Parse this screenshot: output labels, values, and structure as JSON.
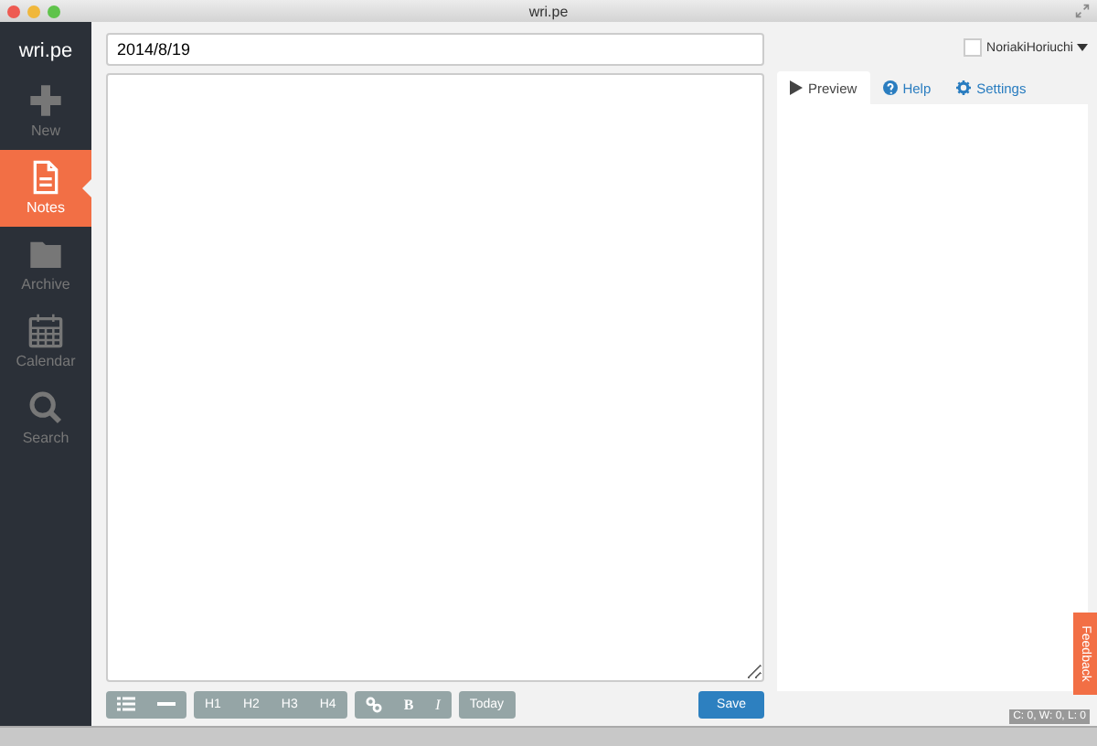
{
  "window": {
    "title": "wri.pe"
  },
  "sidebar": {
    "logo": "wri.pe",
    "items": [
      {
        "label": "New",
        "selected": false
      },
      {
        "label": "Notes",
        "selected": true
      },
      {
        "label": "Archive",
        "selected": false
      },
      {
        "label": "Calendar",
        "selected": false
      },
      {
        "label": "Search",
        "selected": false
      }
    ]
  },
  "editor": {
    "title_value": "2014/8/19"
  },
  "toolbar": {
    "groups": [
      [
        {
          "kind": "list"
        },
        {
          "kind": "rule"
        }
      ],
      [
        {
          "kind": "text",
          "label": "H1"
        },
        {
          "kind": "text",
          "label": "H2"
        },
        {
          "kind": "text",
          "label": "H3"
        },
        {
          "kind": "text",
          "label": "H4"
        }
      ],
      [
        {
          "kind": "link"
        },
        {
          "kind": "bold",
          "label": "B"
        },
        {
          "kind": "italic",
          "label": "I"
        }
      ],
      [
        {
          "kind": "text",
          "label": "Today"
        }
      ]
    ],
    "save": "Save"
  },
  "user": {
    "name": "NoriakiHoriuchi"
  },
  "tabs": [
    {
      "label": "Preview",
      "selected": true
    },
    {
      "label": "Help",
      "selected": false
    },
    {
      "label": "Settings",
      "selected": false
    }
  ],
  "counter": "C: 0, W: 0, L: 0",
  "feedback": "Feedback"
}
